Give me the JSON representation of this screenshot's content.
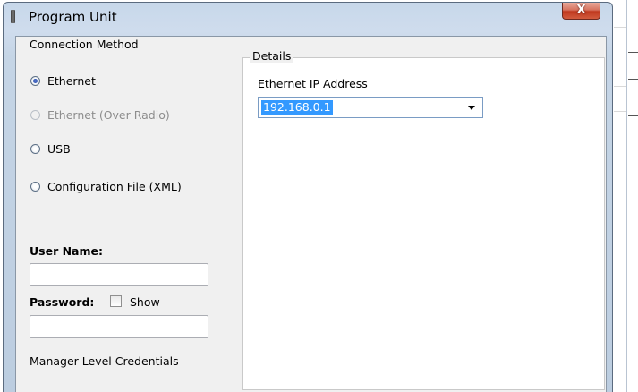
{
  "window": {
    "title": "Program Unit",
    "close_label": "X"
  },
  "connection": {
    "title": "Connection Method",
    "options": [
      {
        "label": "Ethernet",
        "checked": true,
        "disabled": false
      },
      {
        "label": "Ethernet (Over Radio)",
        "checked": false,
        "disabled": true
      },
      {
        "label": "USB",
        "checked": false,
        "disabled": false
      },
      {
        "label": "Configuration File (XML)",
        "checked": false,
        "disabled": false
      }
    ]
  },
  "credentials": {
    "username_label": "User Name:",
    "username_value": "",
    "password_label": "Password:",
    "password_value": "",
    "show_label": "Show",
    "show_checked": false,
    "note": "Manager Level Credentials"
  },
  "details": {
    "title": "Details",
    "ip_label": "Ethernet IP Address",
    "ip_value": "192.168.0.1"
  },
  "colors": {
    "selection": "#3399ff",
    "close_button": "#c0391f",
    "frame": "#c7d8ea"
  }
}
